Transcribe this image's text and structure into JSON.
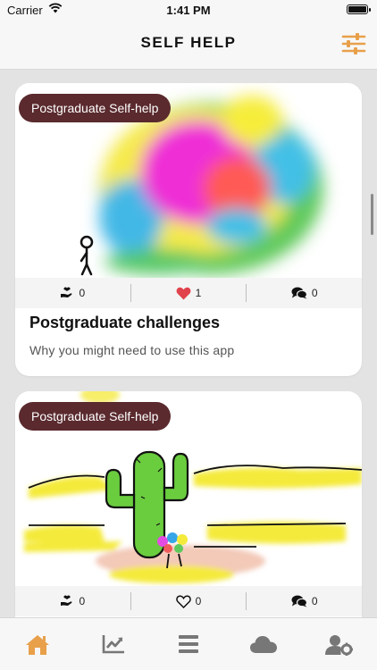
{
  "status_bar": {
    "carrier": "Carrier",
    "time": "1:41 PM"
  },
  "header": {
    "title": "SELF HELP",
    "filter_icon": "sliders-icon",
    "accent_color": "#e8a04a"
  },
  "cards": [
    {
      "tag": "Postgraduate Self-help",
      "image": "watercolor-blob-with-stick-figure",
      "stats": {
        "support": "0",
        "likes": "1",
        "comments": "0",
        "liked": true
      },
      "title": "Postgraduate challenges",
      "subtitle": "Why you might need to use this app"
    },
    {
      "tag": "Postgraduate Self-help",
      "image": "cactus-desert-drawing",
      "stats": {
        "support": "0",
        "likes": "0",
        "comments": "0",
        "liked": false
      }
    }
  ],
  "tabbar": {
    "items": [
      {
        "name": "home",
        "icon": "home-icon",
        "active": true
      },
      {
        "name": "progress",
        "icon": "chart-icon",
        "active": false
      },
      {
        "name": "menu",
        "icon": "menu-icon",
        "active": false
      },
      {
        "name": "cloud",
        "icon": "cloud-icon",
        "active": false
      },
      {
        "name": "account",
        "icon": "user-settings-icon",
        "active": false
      }
    ],
    "active_color": "#e8a04a",
    "inactive_color": "#777777"
  },
  "colors": {
    "tag_bg": "#5a2a2e",
    "heart": "#e0434b"
  }
}
